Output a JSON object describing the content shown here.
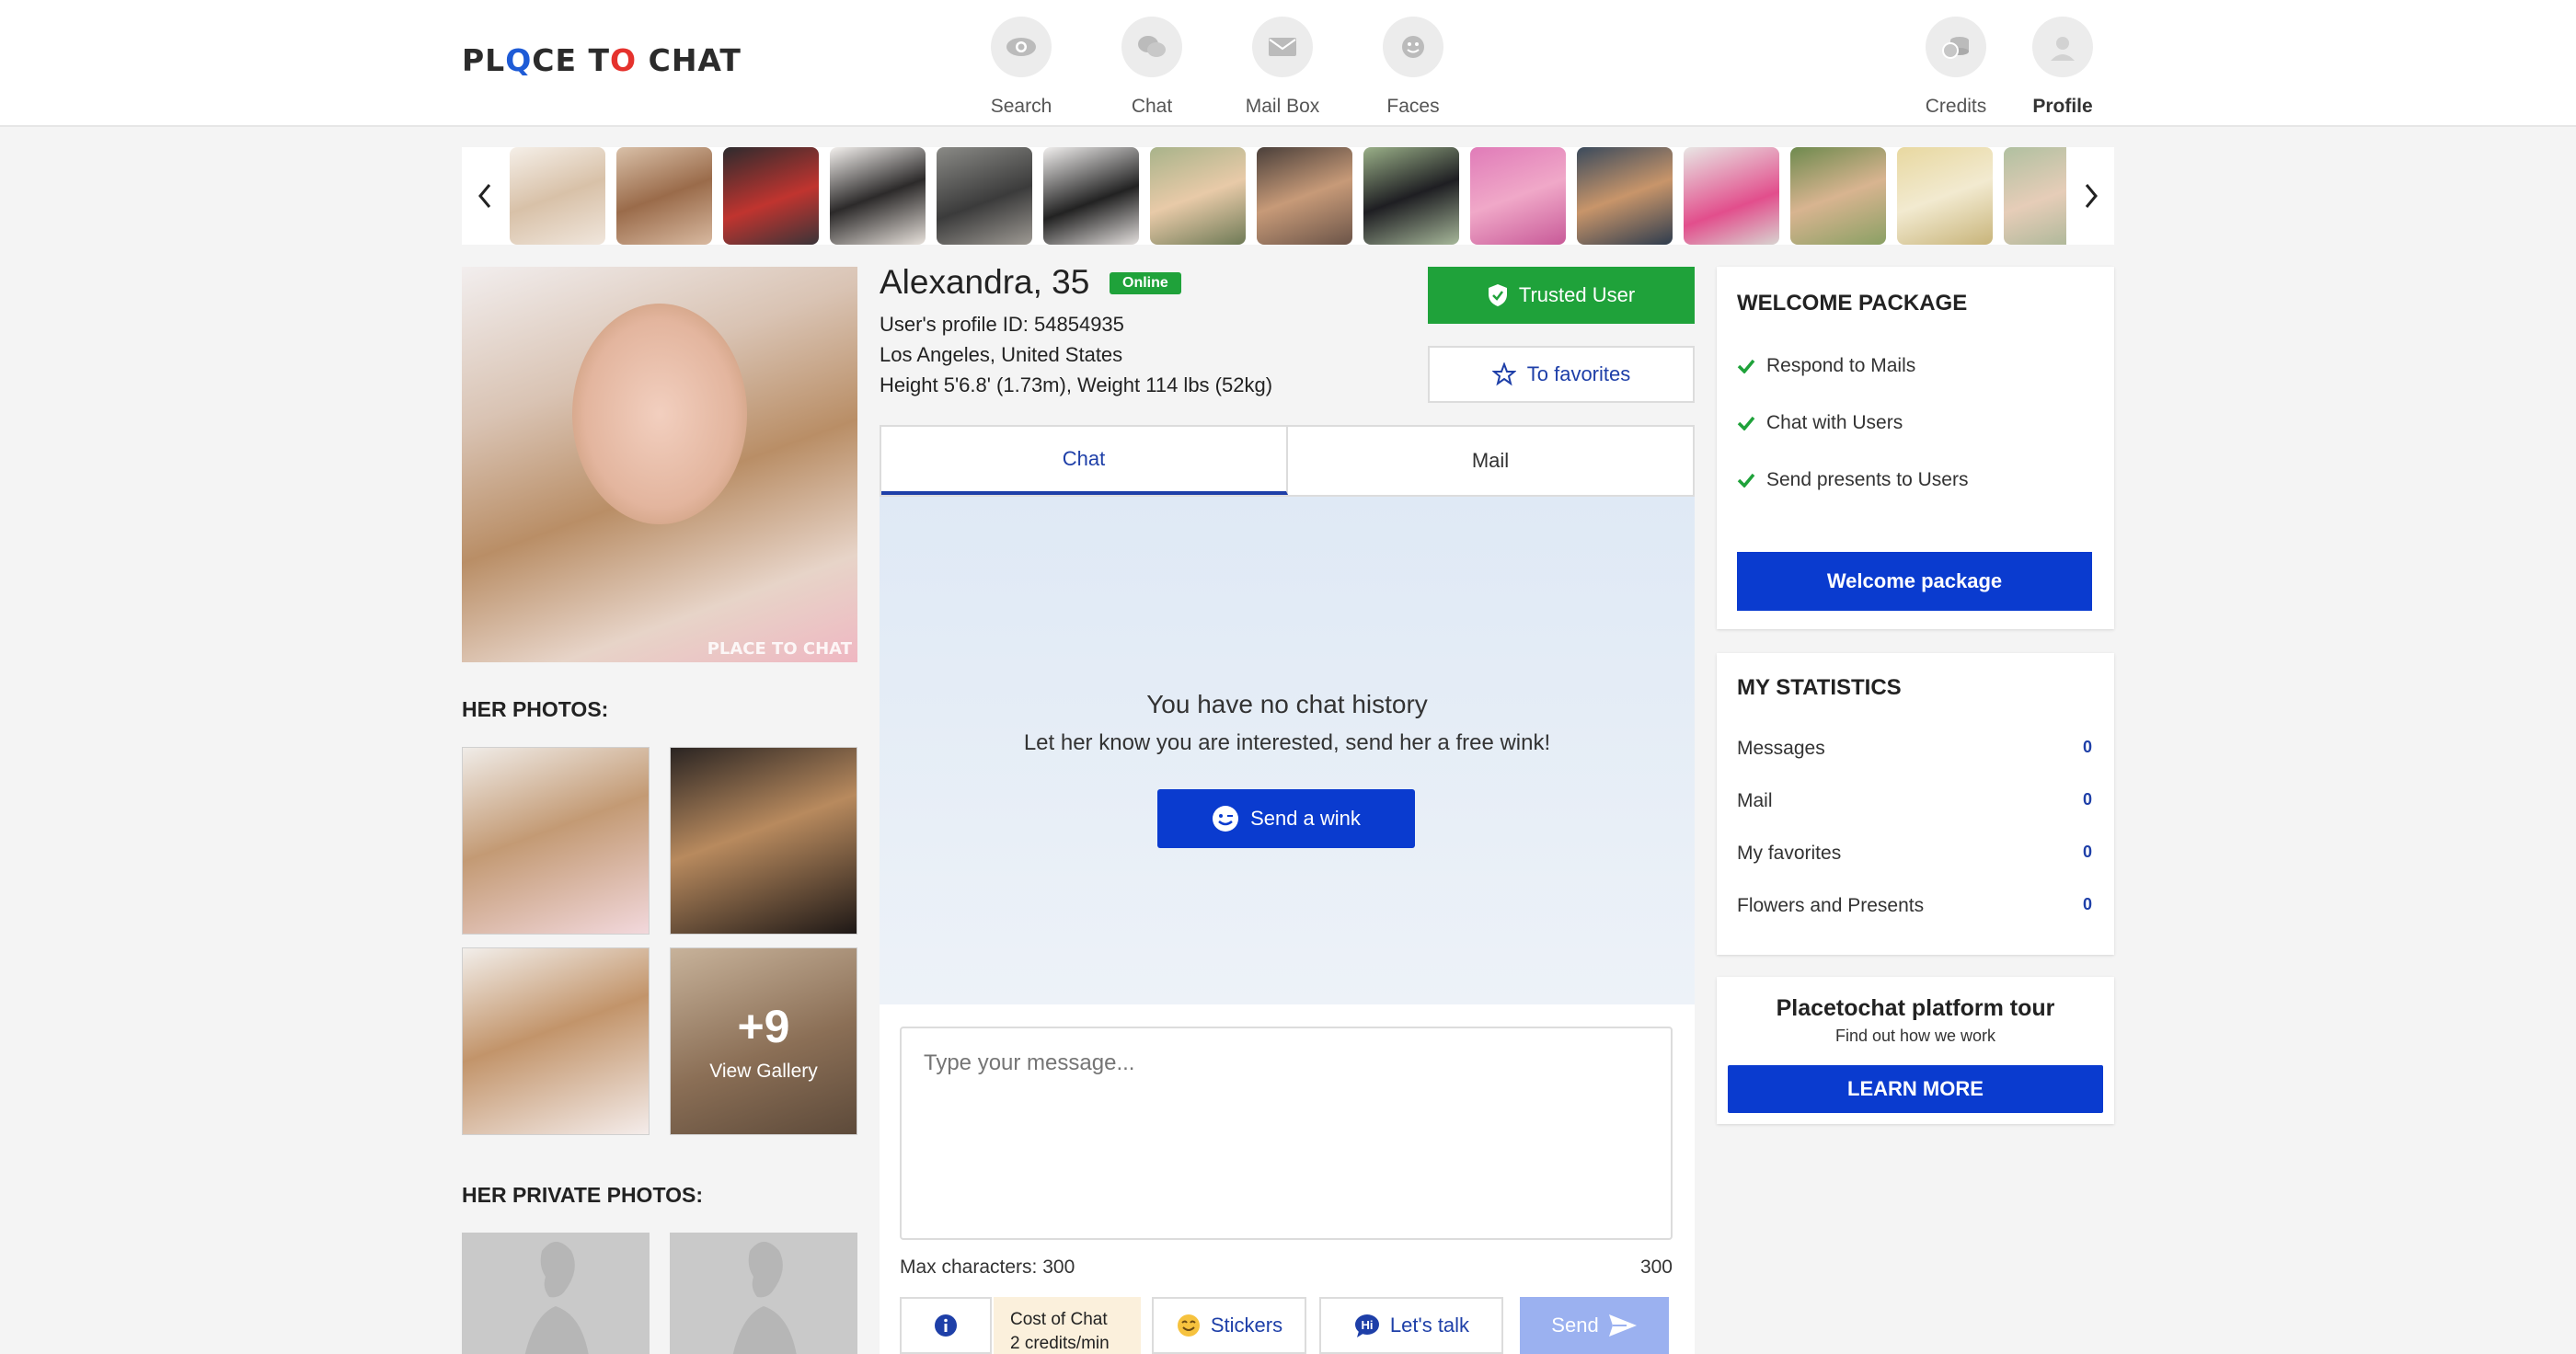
{
  "header": {
    "logo": {
      "p1": "PL",
      "o1": "Q",
      "p2": "CE T",
      "o2": "O",
      "p3": " CHAT"
    },
    "nav": [
      {
        "label": "Search",
        "icon": "eye-icon"
      },
      {
        "label": "Chat",
        "icon": "chat-bubbles-icon"
      },
      {
        "label": "Mail Box",
        "icon": "envelope-icon"
      },
      {
        "label": "Faces",
        "icon": "smiley-icon"
      }
    ],
    "credits_label": "Credits",
    "profile_label": "Profile"
  },
  "profile": {
    "name_age": "Alexandra, 35",
    "status": "Online",
    "profile_id": "User's profile ID: 54854935",
    "location": "Los Angeles, United States",
    "physique": "Height 5'6.8' (1.73m), Weight 114 lbs (52kg)",
    "watermark": "PLACE TO CHAT",
    "photos_title": "HER PHOTOS:",
    "gallery_more": "+9",
    "gallery_label": "View Gallery",
    "private_title": "HER PRIVATE PHOTOS:"
  },
  "actions": {
    "trusted": "Trusted User",
    "favorites": "To favorites"
  },
  "tabs": [
    {
      "label": "Chat",
      "active": true
    },
    {
      "label": "Mail",
      "active": false
    }
  ],
  "chat": {
    "empty_title": "You have no chat history",
    "empty_sub": "Let her know you are interested, send her a free wink!",
    "wink_button": "Send a wink",
    "placeholder": "Type your message...",
    "max_chars_label": "Max characters: 300",
    "chars_left": "300",
    "cost_title": "Cost of Chat",
    "cost_value": "2 credits/min",
    "stickers": "Stickers",
    "lets_talk": "Let's talk",
    "send": "Send"
  },
  "welcome": {
    "title": "WELCOME PACKAGE",
    "items": [
      "Respond to Mails",
      "Chat with Users",
      "Send presents to Users"
    ],
    "button": "Welcome package"
  },
  "stats": {
    "title": "MY STATISTICS",
    "rows": [
      {
        "label": "Messages",
        "value": "0"
      },
      {
        "label": "Mail",
        "value": "0"
      },
      {
        "label": "My favorites",
        "value": "0"
      },
      {
        "label": "Flowers and Presents",
        "value": "0"
      }
    ]
  },
  "tour": {
    "title": "Placetochat platform tour",
    "sub": "Find out how we work",
    "button": "LEARN MORE"
  },
  "colors": {
    "accent_blue": "#0a3bcf",
    "green": "#1fa23a",
    "link_blue": "#1e3fa8"
  }
}
